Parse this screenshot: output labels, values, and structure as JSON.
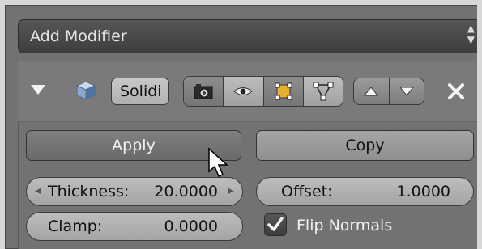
{
  "add_modifier": {
    "label": "Add Modifier",
    "icon": "updown-arrows-icon"
  },
  "modifier_header": {
    "expand_icon": "triangle-down-icon",
    "modifier_type_icon": "cube-icon",
    "name_value": "Solidi",
    "visibility_toggles": [
      {
        "name": "render-icon",
        "active": true
      },
      {
        "name": "eye-icon",
        "active": false
      },
      {
        "name": "editmode-icon",
        "active": false
      },
      {
        "name": "vertex-triangle-icon",
        "active": false
      }
    ],
    "move_up_icon": "arrow-up-icon",
    "move_down_icon": "arrow-down-icon",
    "remove_icon": "close-icon"
  },
  "buttons": {
    "apply": "Apply",
    "copy": "Copy"
  },
  "fields": {
    "thickness": {
      "label": "Thickness:",
      "value": "20.0000"
    },
    "offset": {
      "label": "Offset:",
      "value": "1.0000"
    },
    "clamp": {
      "label": "Clamp:",
      "value": "0.0000"
    }
  },
  "flip_normals": {
    "label": "Flip Normals",
    "checked": true
  },
  "colors": {
    "panel": "#727272",
    "button_dark": "#6a6a6a",
    "field": "#b0b0b0"
  }
}
